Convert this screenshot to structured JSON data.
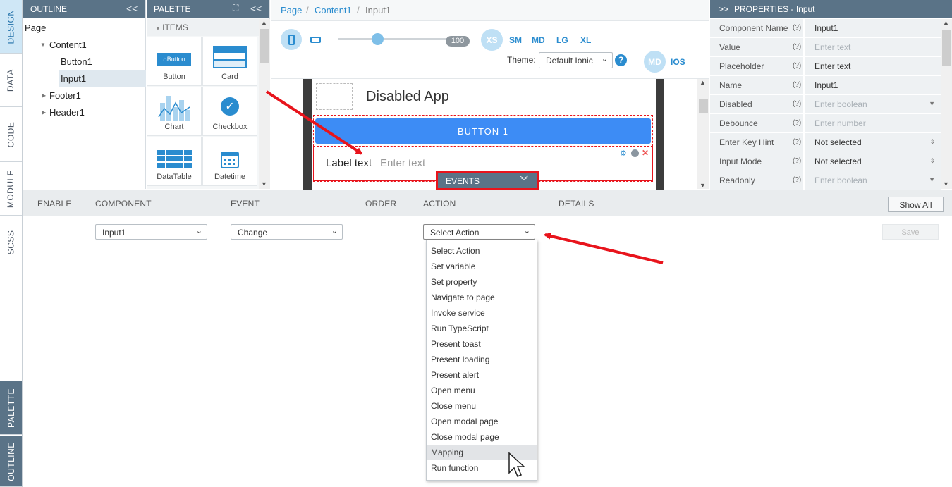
{
  "side_tabs": {
    "design": "DESIGN",
    "data": "DATA",
    "code": "CODE",
    "module": "MODULE",
    "scss": "SCSS",
    "palette": "PALETTE",
    "outline": "OUTLINE"
  },
  "outline": {
    "title": "OUTLINE",
    "collapse": "<<",
    "items": [
      "Page",
      "Content1",
      "Button1",
      "Input1",
      "Footer1",
      "Header1"
    ]
  },
  "palette": {
    "title": "PALETTE",
    "collapse": "<<",
    "section": "ITEMS",
    "items": [
      {
        "label": "Button",
        "icon": "button-icon",
        "thumb": "Button"
      },
      {
        "label": "Card",
        "icon": "card-icon"
      },
      {
        "label": "Chart",
        "icon": "chart-icon"
      },
      {
        "label": "Checkbox",
        "icon": "checkbox-icon"
      },
      {
        "label": "DataTable",
        "icon": "datatable-icon"
      },
      {
        "label": "Datetime",
        "icon": "calendar-icon"
      }
    ]
  },
  "breadcrumb": [
    "Page",
    "Content1",
    "Input1"
  ],
  "toolbar": {
    "zoom": "100",
    "breakpoints": [
      "XS",
      "SM",
      "MD",
      "LG",
      "XL"
    ],
    "theme_label": "Theme:",
    "theme_value": "Default Ionic",
    "modes": [
      "MD",
      "IOS"
    ]
  },
  "canvas": {
    "app_title": "Disabled App",
    "button_label": "BUTTON 1",
    "input_label": "Label text",
    "input_placeholder": "Enter text",
    "events_tab": "EVENTS"
  },
  "properties": {
    "title": "PROPERTIES - Input",
    "rows": [
      {
        "k": "Component Name",
        "q": "(?)",
        "v": "Input1",
        "ph": false,
        "arrow": ""
      },
      {
        "k": "Value",
        "q": "(?)",
        "v": "Enter text",
        "ph": true,
        "arrow": ""
      },
      {
        "k": "Placeholder",
        "q": "(?)",
        "v": "Enter text",
        "ph": false,
        "arrow": ""
      },
      {
        "k": "Name",
        "q": "(?)",
        "v": "Input1",
        "ph": false,
        "arrow": ""
      },
      {
        "k": "Disabled",
        "q": "(?)",
        "v": "Enter boolean",
        "ph": true,
        "arrow": "▼"
      },
      {
        "k": "Debounce",
        "q": "(?)",
        "v": "Enter number",
        "ph": true,
        "arrow": ""
      },
      {
        "k": "Enter Key Hint",
        "q": "(?)",
        "v": "Not selected",
        "ph": false,
        "arrow": "⇕"
      },
      {
        "k": "Input Mode",
        "q": "(?)",
        "v": "Not selected",
        "ph": false,
        "arrow": "⇕"
      },
      {
        "k": "Readonly",
        "q": "(?)",
        "v": "Enter boolean",
        "ph": true,
        "arrow": "▼"
      }
    ]
  },
  "events": {
    "columns": {
      "enable": "ENABLE",
      "component": "COMPONENT",
      "event": "EVENT",
      "order": "ORDER",
      "action": "ACTION",
      "details": "DETAILS"
    },
    "show_all": "Show All",
    "save": "Save",
    "component_value": "Input1",
    "event_value": "Change",
    "action_value": "Select Action",
    "action_options": [
      "Select Action",
      "Set variable",
      "Set property",
      "Navigate to page",
      "Invoke service",
      "Run TypeScript",
      "Present toast",
      "Present loading",
      "Present alert",
      "Open menu",
      "Close menu",
      "Open modal page",
      "Close modal page",
      "Mapping",
      "Run function"
    ],
    "highlighted_option": "Mapping"
  },
  "colors": {
    "accent": "#5a7387",
    "brand_blue": "#2a8ccf",
    "button_blue": "#3d8cf5",
    "annotation_red": "#e8141c"
  }
}
